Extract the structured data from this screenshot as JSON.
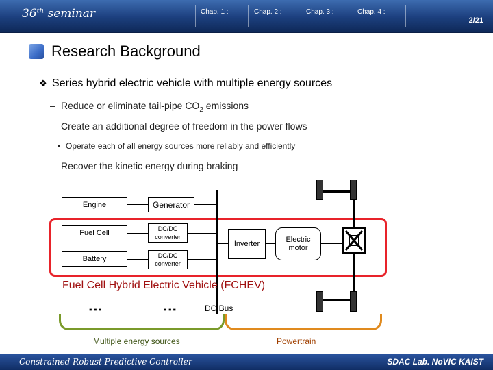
{
  "header": {
    "seminar_num": "36",
    "seminar_sup": "th",
    "seminar_word": " seminar",
    "chapters": [
      "Chap. 1 :",
      "Chap. 2 :",
      "Chap. 3 :",
      "Chap. 4 :"
    ],
    "page": "2/21"
  },
  "slide": {
    "title": "Research Background",
    "main_point": "Series hybrid electric vehicle with multiple energy sources",
    "sub_points": {
      "reduce_pre": "Reduce or eliminate tail-pipe CO",
      "reduce_sub": "2",
      "reduce_post": " emissions",
      "freedom": "Create an additional degree of freedom in the power flows",
      "operate": "Operate each of all energy sources more reliably and efficiently",
      "recover": "Recover the kinetic energy during braking"
    },
    "dash": "–",
    "bullet_small": "•",
    "bullet_diamond": "❖"
  },
  "diagram": {
    "engine": "Engine",
    "generator": "Generator",
    "fuel_cell": "Fuel Cell",
    "dcdc_1": "DC/DC converter",
    "battery": "Battery",
    "dcdc_2": "DC/DC converter",
    "inverter": "Inverter",
    "electric_motor": "Electric motor",
    "fchev_label": "Fuel Cell Hybrid Electric Vehicle (FCHEV)",
    "dc_bus": "DC Bus",
    "multiple_sources": "Multiple energy sources",
    "powertrain": "Powertrain",
    "colors": {
      "red_frame": "#e8232a",
      "green_bracket": "#7a9a2a",
      "orange_bracket": "#e08a1e",
      "dark_red_text": "#a01010"
    }
  },
  "footer": {
    "left": "Constrained Robust Predictive Controller",
    "right": "SDAC Lab. NoVIC KAIST"
  }
}
